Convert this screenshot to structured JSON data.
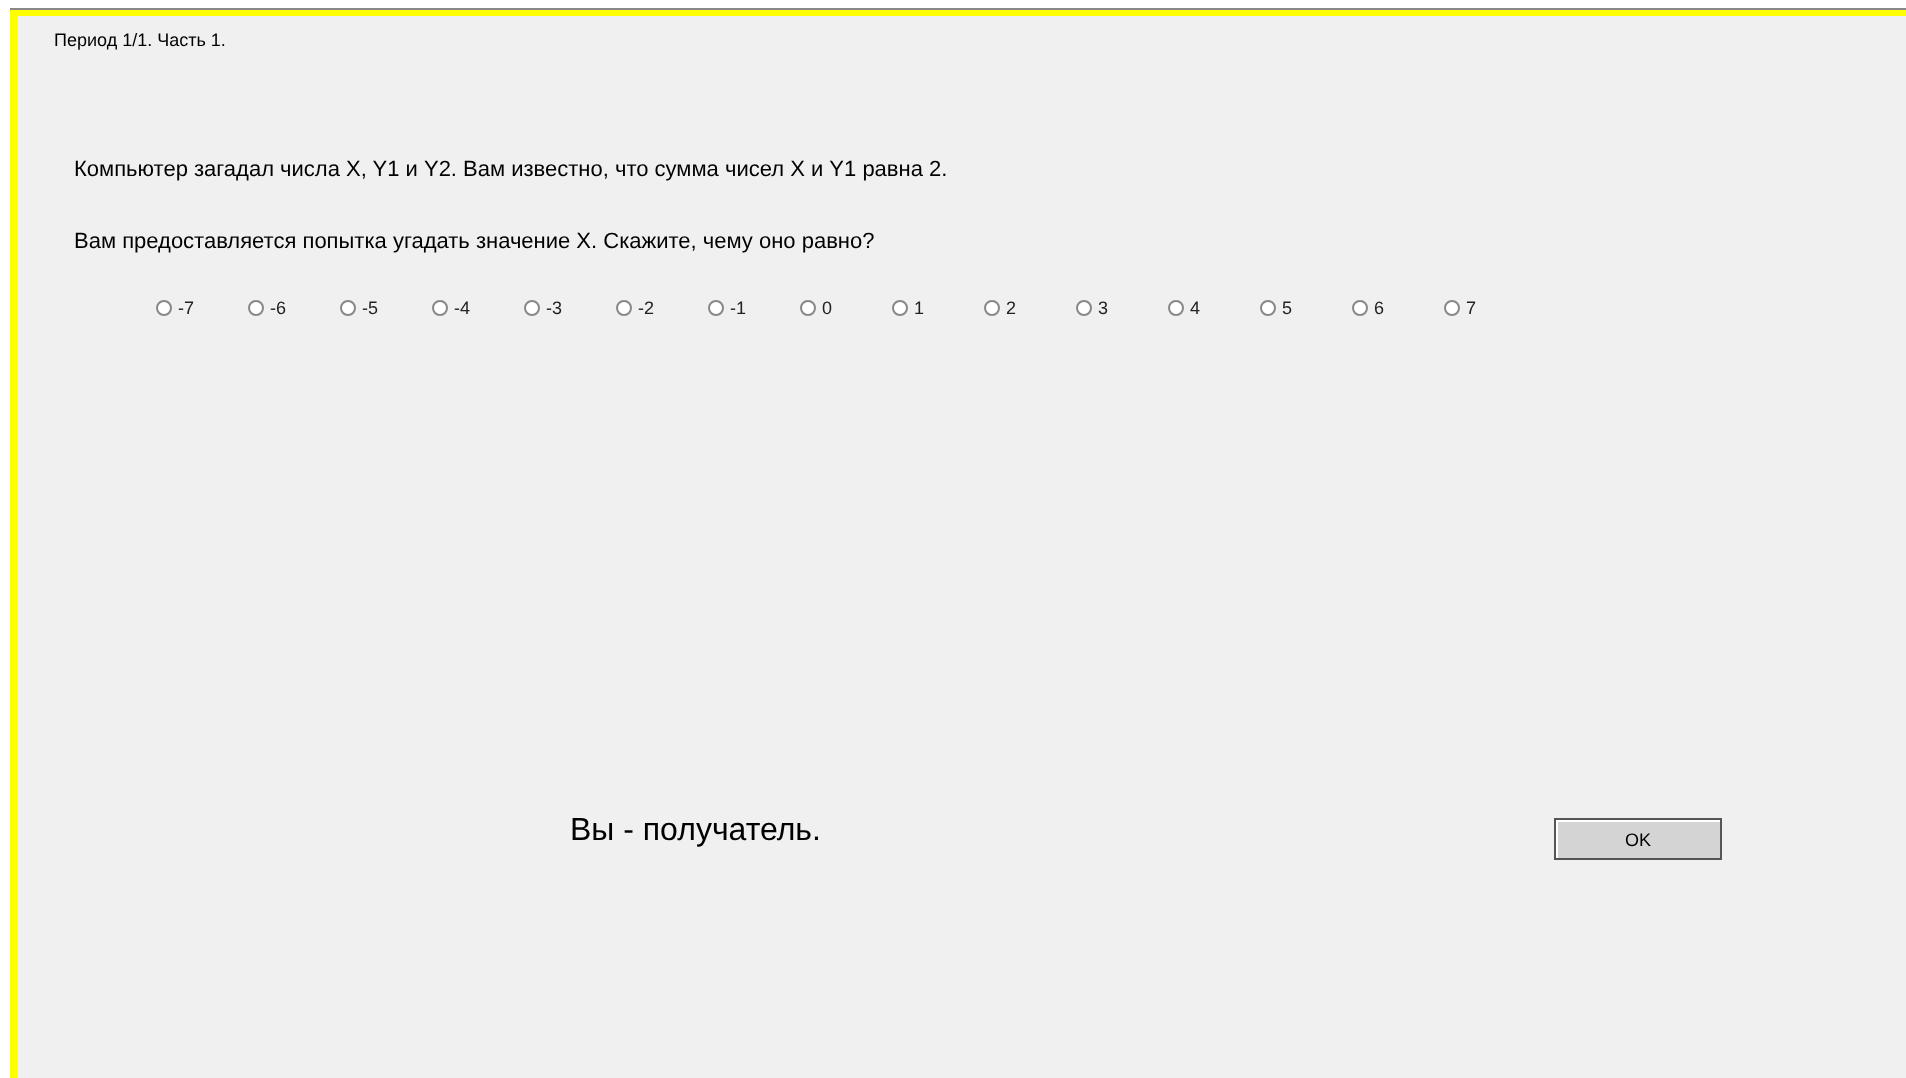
{
  "header": "Период 1/1. Часть 1.",
  "paragraphs": [
    "Компьютер загадал числа X, Y1 и Y2. Вам известно, что сумма чисел X и Y1 равна 2.",
    "Вам предоставляется попытка угадать значение X. Скажите, чему оно равно?"
  ],
  "options": [
    {
      "label": "-7",
      "selected": false
    },
    {
      "label": "-6",
      "selected": false
    },
    {
      "label": "-5",
      "selected": false
    },
    {
      "label": "-4",
      "selected": false
    },
    {
      "label": "-3",
      "selected": false
    },
    {
      "label": "-2",
      "selected": false
    },
    {
      "label": "-1",
      "selected": false
    },
    {
      "label": "0",
      "selected": false
    },
    {
      "label": "1",
      "selected": false
    },
    {
      "label": "2",
      "selected": false
    },
    {
      "label": "3",
      "selected": false
    },
    {
      "label": "4",
      "selected": false
    },
    {
      "label": "5",
      "selected": false
    },
    {
      "label": "6",
      "selected": false
    },
    {
      "label": "7",
      "selected": false
    }
  ],
  "role_text": "Вы - получатель.",
  "ok_button": "OK"
}
